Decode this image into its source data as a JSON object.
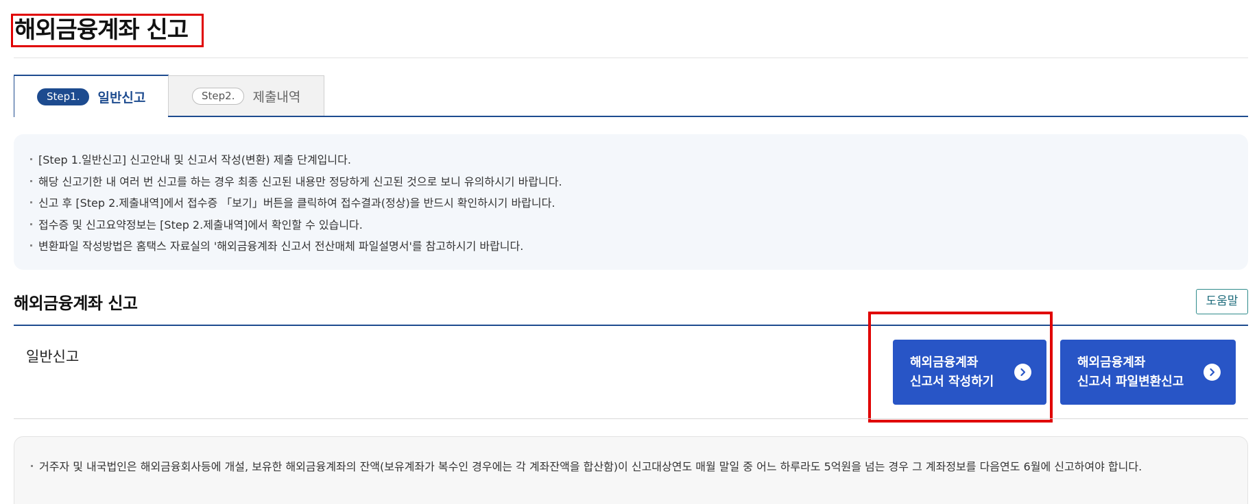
{
  "page": {
    "title": "해외금융계좌 신고"
  },
  "tabs": [
    {
      "step": "Step1.",
      "label": "일반신고",
      "active": true
    },
    {
      "step": "Step2.",
      "label": "제출내역",
      "active": false
    }
  ],
  "info": {
    "items": [
      "[Step 1.일반신고] 신고안내 및 신고서 작성(변환) 제출 단계입니다.",
      "해당 신고기한 내 여러 번 신고를 하는 경우 최종 신고된 내용만 정당하게 신고된 것으로 보니 유의하시기 바랍니다.",
      "신고 후 [Step 2.제출내역]에서 접수증 「보기」버튼을 클릭하여 접수결과(정상)을 반드시 확인하시기 바랍니다.",
      "접수증 및 신고요약정보는 [Step 2.제출내역]에서 확인할 수 있습니다.",
      "변환파일 작성방법은 홈택스 자료실의 '해외금융계좌 신고서 전산매체 파일설명서'를 참고하시기 바랍니다."
    ]
  },
  "section": {
    "title": "해외금융계좌 신고",
    "help_label": "도움말",
    "row_label": "일반신고",
    "buttons": [
      {
        "line1": "해외금융계좌",
        "line2": "신고서 작성하기",
        "icon": "chevron-right-circle-icon"
      },
      {
        "line1": "해외금융계좌",
        "line2": "신고서 파일변환신고",
        "icon": "chevron-right-circle-icon"
      }
    ]
  },
  "note": {
    "text": "거주자 및 내국법인은 해외금융회사등에 개설, 보유한 해외금융계좌의 잔액(보유계좌가 복수인 경우에는 각 계좌잔액을 합산함)이 신고대상연도 매월 말일 중 어느 하루라도 5억원을 넘는 경우 그 계좌정보를 다음연도 6월에 신고하여야 합니다."
  },
  "colors": {
    "primary": "#1d4b8f",
    "button": "#2855c6",
    "highlight": "#e00000"
  }
}
